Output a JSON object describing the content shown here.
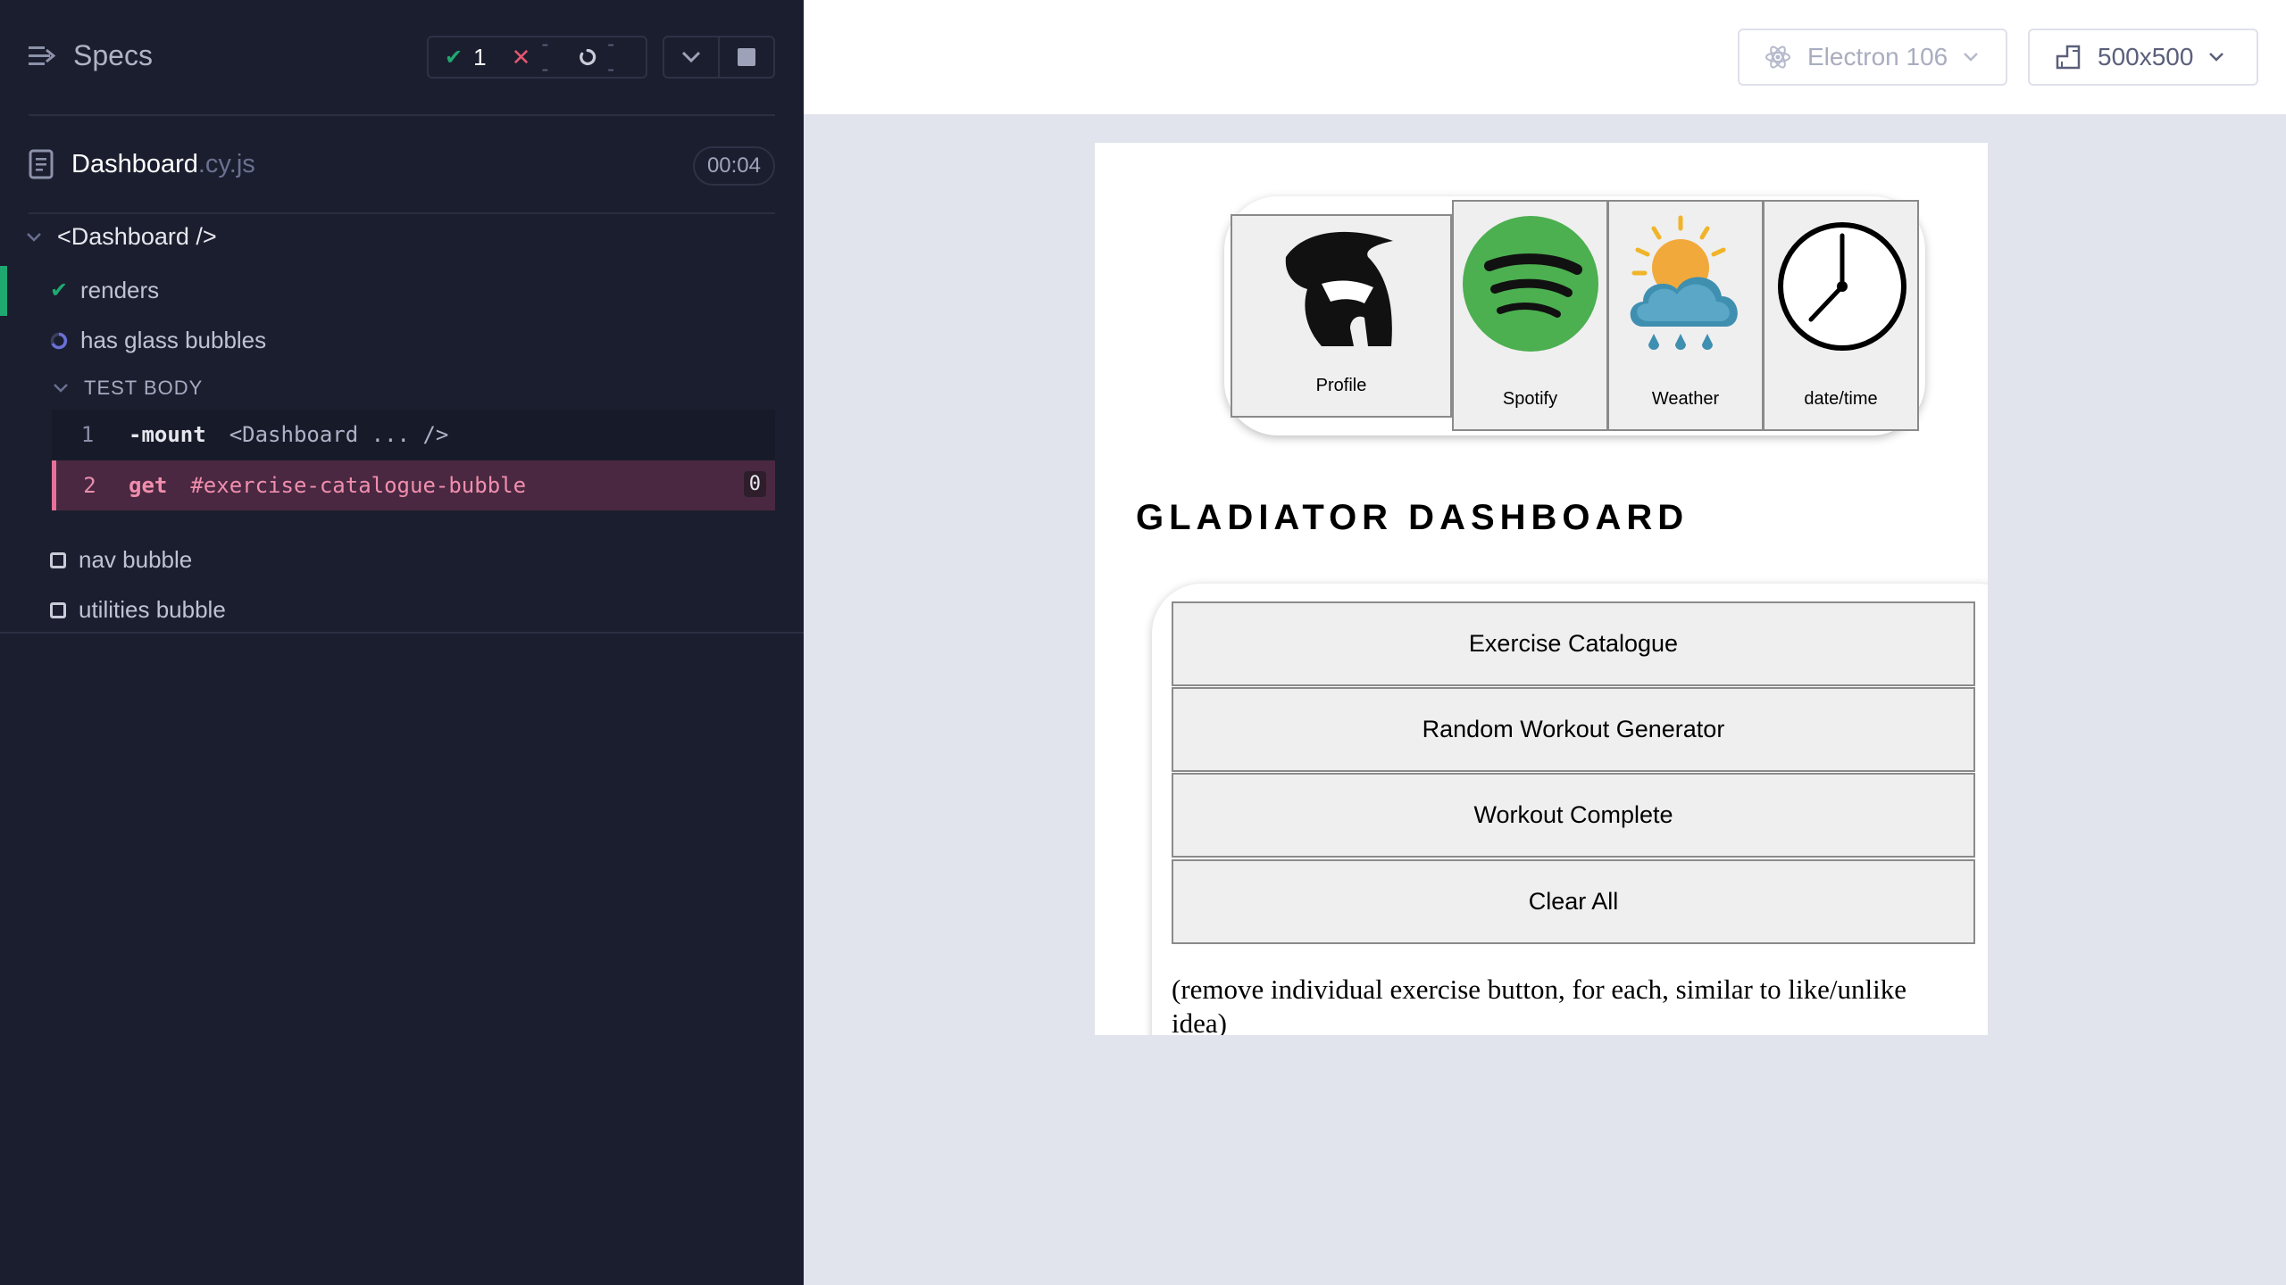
{
  "reporter": {
    "specs_label": "Specs",
    "stats": {
      "passed": "1",
      "failed": "--",
      "pending": "--"
    },
    "file": {
      "name": "Dashboard",
      "ext": ".cy.js",
      "duration": "00:04"
    },
    "suite": {
      "label": "<Dashboard />"
    },
    "tests": [
      {
        "label": "renders",
        "state": "passed"
      },
      {
        "label": "has glass bubbles",
        "state": "running"
      },
      {
        "label": "nav bubble",
        "state": "pending"
      },
      {
        "label": "utilities bubble",
        "state": "pending"
      }
    ],
    "test_body": {
      "label": "TEST BODY",
      "commands": [
        {
          "line": "1",
          "name": "-mount",
          "message": "<Dashboard ... />"
        },
        {
          "line": "2",
          "name": "get",
          "message": "#exercise-catalogue-bubble",
          "count": "0"
        }
      ]
    },
    "colors": {
      "background": "#1b1e2e",
      "pass": "#1fa971",
      "fail": "#e45770",
      "running": "#6a70d6"
    }
  },
  "aut": {
    "browser": "Electron 106",
    "viewport": "500x500",
    "page": {
      "nav_tiles": [
        {
          "label": "Profile",
          "icon": "spartan-helmet-icon"
        },
        {
          "label": "Spotify",
          "icon": "spotify-icon"
        },
        {
          "label": "Weather",
          "icon": "weather-icon"
        },
        {
          "label": "date/time",
          "icon": "clock-icon"
        }
      ],
      "title": "GLADIATOR DASHBOARD",
      "buttons": [
        "Exercise Catalogue",
        "Random Workout Generator",
        "Workout Complete",
        "Clear All"
      ],
      "note": "(remove individual exercise button, for each, similar to like/unlike idea)"
    }
  }
}
